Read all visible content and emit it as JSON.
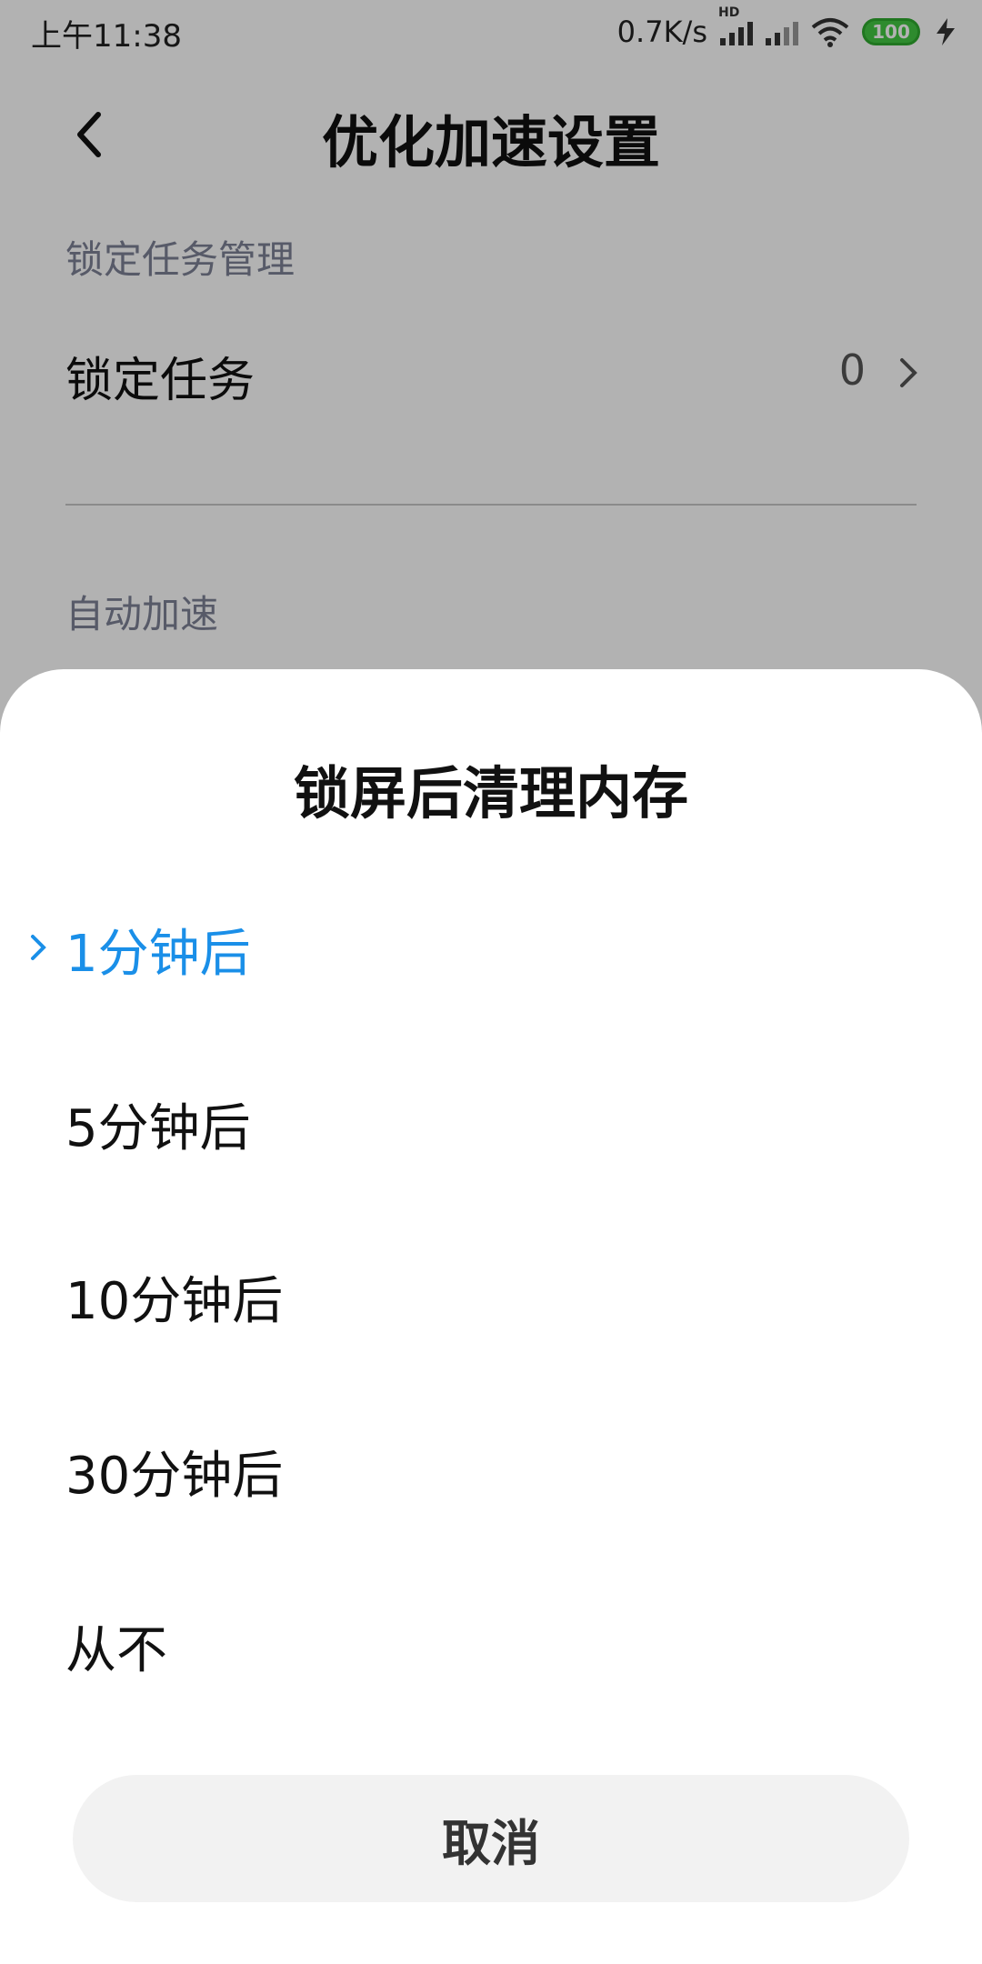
{
  "status_bar": {
    "time": "上午11:38",
    "net_speed": "0.7K/s",
    "hd_label": "HD",
    "battery": "100"
  },
  "header": {
    "title": "优化加速设置"
  },
  "sections": {
    "lock_manage_label": "锁定任务管理",
    "lock_task_label": "锁定任务",
    "lock_task_count": "0",
    "auto_speed_label": "自动加速"
  },
  "sheet": {
    "title": "锁屏后清理内存",
    "options": [
      {
        "label": "1分钟后",
        "selected": true
      },
      {
        "label": "5分钟后",
        "selected": false
      },
      {
        "label": "10分钟后",
        "selected": false
      },
      {
        "label": "30分钟后",
        "selected": false
      },
      {
        "label": "从不",
        "selected": false
      }
    ],
    "selected_color": "#1a8fe8",
    "cancel_label": "取消"
  }
}
